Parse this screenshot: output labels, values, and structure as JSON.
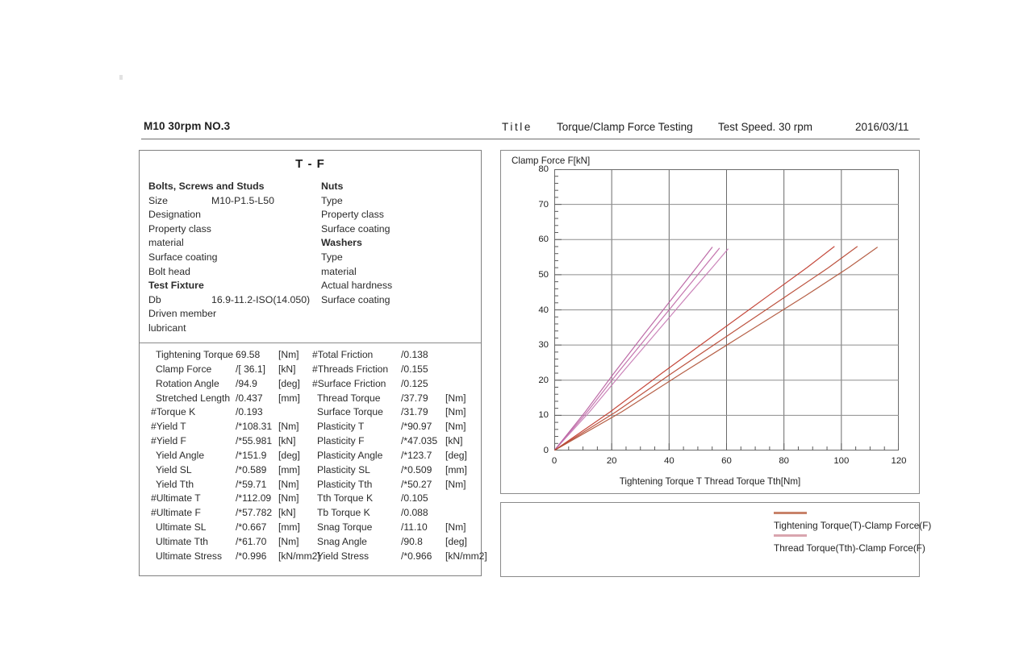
{
  "header": {
    "document_id": "M10 30rpm NO.3",
    "title_label": "Title",
    "title_value": "Torque/Clamp Force Testing",
    "speed_label": "Test Speed.",
    "speed_value": "30 rpm",
    "date": "2016/03/11"
  },
  "spec": {
    "panel_title": "T - F",
    "left": [
      {
        "label": "Bolts, Screws and Studs",
        "value": "",
        "bold": true
      },
      {
        "label": "Size",
        "value": "M10-P1.5-L50",
        "bold": false
      },
      {
        "label": "Designation",
        "value": "",
        "bold": false
      },
      {
        "label": "Property class",
        "value": "",
        "bold": false
      },
      {
        "label": "material",
        "value": "",
        "bold": false
      },
      {
        "label": "Surface coating",
        "value": "",
        "bold": false
      },
      {
        "label": "Bolt head",
        "value": "",
        "bold": false
      },
      {
        "label": "Test Fixture",
        "value": "",
        "bold": true
      },
      {
        "label": "Db",
        "value": "16.9-11.2-ISO(14.050)",
        "bold": false
      },
      {
        "label": "Driven member",
        "value": "",
        "bold": false
      },
      {
        "label": "lubricant",
        "value": "",
        "bold": false
      }
    ],
    "right": [
      {
        "label": "Nuts",
        "value": "",
        "bold": true
      },
      {
        "label": "Type",
        "value": "",
        "bold": false
      },
      {
        "label": "Property class",
        "value": "",
        "bold": false
      },
      {
        "label": "Surface coating",
        "value": "",
        "bold": false
      },
      {
        "label": "Washers",
        "value": "",
        "bold": true
      },
      {
        "label": "Type",
        "value": "",
        "bold": false
      },
      {
        "label": "material",
        "value": "",
        "bold": false
      },
      {
        "label": "Actual hardness",
        "value": "",
        "bold": false
      },
      {
        "label": "Surface coating",
        "value": "",
        "bold": false
      }
    ]
  },
  "measurements": {
    "left": [
      {
        "label": "Tightening Torque",
        "indent": true,
        "value": "69.58",
        "unit": "[Nm]"
      },
      {
        "label": "Clamp Force",
        "indent": true,
        "value": "/[ 36.1]",
        "unit": "[kN]"
      },
      {
        "label": "Rotation Angle",
        "indent": true,
        "value": "/94.9",
        "unit": "[deg]"
      },
      {
        "label": "Stretched Length",
        "indent": true,
        "value": "/0.437",
        "unit": "[mm]"
      },
      {
        "label": "#Torque K",
        "indent": false,
        "value": "/0.193",
        "unit": ""
      },
      {
        "label": "#Yield T",
        "indent": false,
        "value": "/*108.31",
        "unit": "[Nm]"
      },
      {
        "label": "#Yield F",
        "indent": false,
        "value": "/*55.981",
        "unit": "[kN]"
      },
      {
        "label": "Yield Angle",
        "indent": true,
        "value": "/*151.9",
        "unit": "[deg]"
      },
      {
        "label": "Yield SL",
        "indent": true,
        "value": "/*0.589",
        "unit": "[mm]"
      },
      {
        "label": "Yield Tth",
        "indent": true,
        "value": "/*59.71",
        "unit": "[Nm]"
      },
      {
        "label": "#Ultimate T",
        "indent": false,
        "value": "/*112.09",
        "unit": "[Nm]"
      },
      {
        "label": "#Ultimate F",
        "indent": false,
        "value": "/*57.782",
        "unit": "[kN]"
      },
      {
        "label": "Ultimate SL",
        "indent": true,
        "value": "/*0.667",
        "unit": "[mm]"
      },
      {
        "label": "Ultimate Tth",
        "indent": true,
        "value": "/*61.70",
        "unit": "[Nm]"
      },
      {
        "label": "Ultimate Stress",
        "indent": true,
        "value": "/*0.996",
        "unit": "[kN/mm2]"
      }
    ],
    "right": [
      {
        "label": "#Total Friction",
        "indent": false,
        "value": "/0.138",
        "unit": ""
      },
      {
        "label": "#Threads Friction",
        "indent": false,
        "value": "/0.155",
        "unit": ""
      },
      {
        "label": "#Surface Friction",
        "indent": false,
        "value": "/0.125",
        "unit": ""
      },
      {
        "label": "Thread Torque",
        "indent": true,
        "value": "/37.79",
        "unit": "[Nm]"
      },
      {
        "label": "Surface Torque",
        "indent": true,
        "value": "/31.79",
        "unit": "[Nm]"
      },
      {
        "label": "Plasticity T",
        "indent": true,
        "value": "/*90.97",
        "unit": "[Nm]"
      },
      {
        "label": "Plasticity F",
        "indent": true,
        "value": "/*47.035",
        "unit": "[kN]"
      },
      {
        "label": "Plasticity Angle",
        "indent": true,
        "value": "/*123.7",
        "unit": "[deg]"
      },
      {
        "label": "Plasticity SL",
        "indent": true,
        "value": "/*0.509",
        "unit": "[mm]"
      },
      {
        "label": "Plasticity Tth",
        "indent": true,
        "value": "/*50.27",
        "unit": "[Nm]"
      },
      {
        "label": "Tth Torque K",
        "indent": true,
        "value": "/0.105",
        "unit": ""
      },
      {
        "label": "Tb Torque K",
        "indent": true,
        "value": "/0.088",
        "unit": ""
      },
      {
        "label": "Snag Torque",
        "indent": true,
        "value": "/11.10",
        "unit": "[Nm]"
      },
      {
        "label": "Snag Angle",
        "indent": true,
        "value": "/90.8",
        "unit": "[deg]"
      },
      {
        "label": "Yield Stress",
        "indent": true,
        "value": "/*0.966",
        "unit": "[kN/mm2]"
      }
    ]
  },
  "legend": {
    "entries": [
      {
        "label": "Tightening Torque(T)-Clamp Force(F)",
        "color": "#c8836a"
      },
      {
        "label": "Thread Torque(Tth)-Clamp Force(F)",
        "color": "#d9a5ae"
      }
    ]
  },
  "chart_data": {
    "type": "line",
    "title": "",
    "xlabel": "Tightening Torque T Thread Torque Tth[Nm]",
    "ylabel": "Clamp Force F[kN]",
    "xlim": [
      0,
      120
    ],
    "ylim": [
      0,
      80
    ],
    "xticks": [
      0,
      20,
      40,
      60,
      80,
      100,
      120
    ],
    "yticks": [
      0,
      10,
      20,
      30,
      40,
      50,
      60,
      70,
      80
    ],
    "x_minor_step": 5,
    "y_minor_step": 2,
    "grid": true,
    "legend_position": "below-right",
    "series": [
      {
        "name": "Thread Torque(Tth)-Clamp Force(F) run 1",
        "color": "#c06aa8",
        "points": [
          [
            0,
            0
          ],
          [
            11.5,
            11.0
          ],
          [
            22.0,
            22.0
          ],
          [
            33.0,
            33.0
          ],
          [
            44.0,
            44.0
          ],
          [
            52.0,
            52.0
          ],
          [
            57.5,
            57.5
          ]
        ]
      },
      {
        "name": "Thread Torque(Tth)-Clamp Force(F) run 2",
        "color": "#c77ab4",
        "points": [
          [
            0,
            0
          ],
          [
            12.3,
            11.0
          ],
          [
            23.5,
            22.0
          ],
          [
            35.0,
            33.0
          ],
          [
            46.5,
            44.0
          ],
          [
            55.0,
            52.0
          ],
          [
            60.5,
            57.3
          ]
        ]
      },
      {
        "name": "Thread Torque(Tth)-Clamp Force(F) run 3",
        "color": "#b85fa0",
        "points": [
          [
            0,
            0
          ],
          [
            10.8,
            11.0
          ],
          [
            20.8,
            22.0
          ],
          [
            31.2,
            33.0
          ],
          [
            41.8,
            44.0
          ],
          [
            49.5,
            52.0
          ],
          [
            55.0,
            57.8
          ]
        ]
      },
      {
        "name": "Tightening Torque(T)-Clamp Force(F) run 1",
        "color": "#c0392b",
        "points": [
          [
            0,
            0
          ],
          [
            19.5,
            11.0
          ],
          [
            37.5,
            22.0
          ],
          [
            56.0,
            33.0
          ],
          [
            74.5,
            44.0
          ],
          [
            88.0,
            52.0
          ],
          [
            97.5,
            58.0
          ]
        ]
      },
      {
        "name": "Tightening Torque(T)-Clamp Force(F) run 2",
        "color": "#b7452f",
        "points": [
          [
            0,
            0
          ],
          [
            21.5,
            11.0
          ],
          [
            41.0,
            22.0
          ],
          [
            61.0,
            33.0
          ],
          [
            81.0,
            44.0
          ],
          [
            95.5,
            52.0
          ],
          [
            105.5,
            58.0
          ]
        ]
      },
      {
        "name": "Tightening Torque(T)-Clamp Force(F) run 3",
        "color": "#b05338",
        "points": [
          [
            0,
            0
          ],
          [
            23.5,
            11.0
          ],
          [
            44.5,
            22.0
          ],
          [
            66.0,
            33.0
          ],
          [
            87.5,
            44.0
          ],
          [
            102.5,
            52.0
          ],
          [
            112.5,
            57.8
          ]
        ]
      }
    ]
  }
}
